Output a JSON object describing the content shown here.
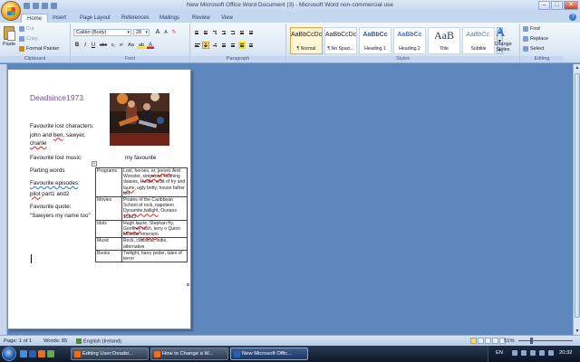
{
  "window": {
    "title": "New Microsoft Office Word Document (3) - Microsoft Word non-commercial use",
    "controls": {
      "minimize": "–",
      "maximize": "□",
      "close": "✕"
    }
  },
  "tabs": [
    "Home",
    "Insert",
    "Page Layout",
    "References",
    "Mailings",
    "Review",
    "View"
  ],
  "ribbon": {
    "clipboard": {
      "label": "Clipboard",
      "paste": "Paste",
      "cut": "Cut",
      "copy": "Copy",
      "format_painter": "Format Painter"
    },
    "font": {
      "label": "Font",
      "font_name": "Calibri (Body)",
      "font_size": "28",
      "grow": "A",
      "shrink": "A",
      "bold": "B",
      "italic": "I",
      "underline": "U",
      "strike": "abc",
      "subscript": "x₂",
      "superscript": "x²",
      "change_case": "Aa",
      "highlight": "ab",
      "font_color": "A"
    },
    "paragraph": {
      "label": "Paragraph"
    },
    "styles": {
      "label": "Styles",
      "gallery": [
        {
          "preview": "AaBbCcDc",
          "name": "¶ Normal"
        },
        {
          "preview": "AaBbCcDc",
          "name": "¶ No Spaci..."
        },
        {
          "preview": "AaBbCc",
          "name": "Heading 1"
        },
        {
          "preview": "AaBbCc",
          "name": "Heading 2"
        },
        {
          "preview": "AaB",
          "name": "Title"
        },
        {
          "preview": "AaBbCc.",
          "name": "Subtitle"
        }
      ],
      "change_styles": "Change Styles"
    },
    "editing": {
      "label": "Editing",
      "find": "Find",
      "replace": "Replace",
      "select": "Select"
    }
  },
  "document": {
    "title": "Deadsince1973",
    "lines": {
      "characters_label": "Favourite lost characters:",
      "characters_line1_a": "john",
      "characters_line1_b": " and ",
      "characters_line1_c": "ben",
      "characters_line1_d": ", sawyer,",
      "characters_line2": "charlie",
      "music_label": "Favourite lost music:",
      "music_value": "my favourite",
      "music_line2": "Parting words",
      "episodes_label": "Favourite episodes",
      "episodes_colon": ":",
      "episodes_a": "pilot",
      "episodes_b": " part1 and2",
      "quote_label": "Favourite quote:",
      "quote_text": "\"Sawyers my name too\""
    },
    "table": [
      {
        "label": "Programs",
        "parts": [
          {
            "t": "Lost, heroes, "
          },
          {
            "t": "er",
            "w": true
          },
          {
            "t": ", "
          },
          {
            "t": "jeeves",
            "w": true
          },
          {
            "t": " And Wooster, "
          },
          {
            "t": "simpsons",
            "w": true
          },
          {
            "t": " Pushing daisies, Hustle, a bit of fry and "
          },
          {
            "t": "laurie",
            "w": true
          },
          {
            "t": ", ugly betty, house father ted"
          }
        ]
      },
      {
        "label": "Movies",
        "parts": [
          {
            "t": "Pirates of the Caribbean School of rock, napoleon "
          },
          {
            "t": "Dynamite,twilight",
            "w": true
          },
          {
            "t": ", Oceans 11&13"
          }
        ]
      },
      {
        "label": "Idols",
        "parts": [
          {
            "t": "Hugh "
          },
          {
            "t": "laurie",
            "w": true
          },
          {
            "t": ", Stephan fry, "
          },
          {
            "t": "Geoffrey",
            "w": true
          },
          {
            "t": " rush, terry o Quinn Michael "
          },
          {
            "t": "emerson",
            "w": true
          }
        ]
      },
      {
        "label": "Music",
        "parts": [
          {
            "t": "Rock, classical, indie, alternative"
          }
        ]
      },
      {
        "label": "Books",
        "parts": [
          {
            "t": "Twilight, harry potter, tales of terror"
          }
        ]
      }
    ]
  },
  "statusbar": {
    "page": "Page: 1 of 1",
    "words": "Words: 85",
    "language": "English (Ireland)",
    "zoom": "51%",
    "zoom_level": 0.51
  },
  "taskbar": {
    "buttons": [
      {
        "label": "Editing User:Deadsi...",
        "color": "#e86f22"
      },
      {
        "label": "How to Change a W...",
        "color": "#e86f22"
      },
      {
        "label": "New Microsoft Offic...",
        "color": "#2b5faa"
      }
    ],
    "language": "EN",
    "clock": "20:32"
  }
}
